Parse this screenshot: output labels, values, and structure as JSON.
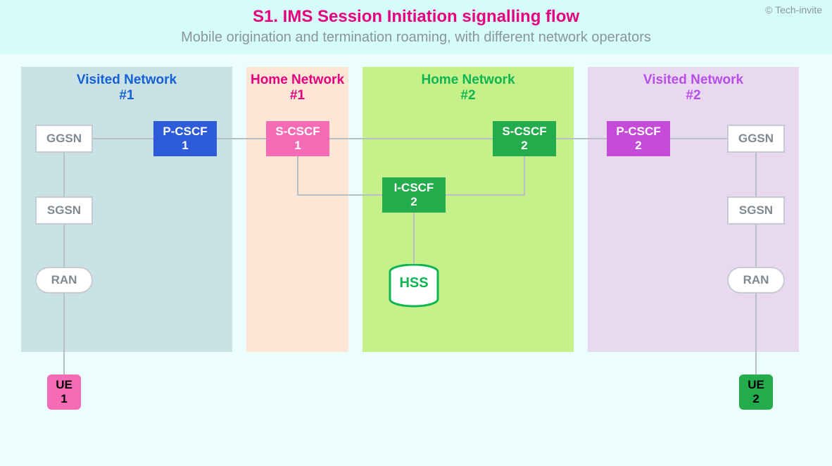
{
  "header": {
    "title": "S1. IMS Session Initiation signalling flow",
    "subtitle": "Mobile origination and termination roaming, with different network operators",
    "credit": "© Tech-invite"
  },
  "panels": {
    "vn1": {
      "line1": "Visited Network",
      "line2": "#1"
    },
    "hn1": {
      "line1": "Home Network",
      "line2": "#1"
    },
    "hn2": {
      "line1": "Home Network",
      "line2": "#2"
    },
    "vn2": {
      "line1": "Visited Network",
      "line2": "#2"
    }
  },
  "nodes": {
    "ggsn1": "GGSN",
    "sgsn1": "SGSN",
    "ran1": "RAN",
    "pcscf1_l1": "P-CSCF",
    "pcscf1_l2": "1",
    "scscf1_l1": "S-CSCF",
    "scscf1_l2": "1",
    "icscf2_l1": "I-CSCF",
    "icscf2_l2": "2",
    "scscf2_l1": "S-CSCF",
    "scscf2_l2": "2",
    "pcscf2_l1": "P-CSCF",
    "pcscf2_l2": "2",
    "ggsn2": "GGSN",
    "sgsn2": "SGSN",
    "ran2": "RAN",
    "hss": "HSS",
    "ue1_l1": "UE",
    "ue1_l2": "1",
    "ue2_l1": "UE",
    "ue2_l2": "2"
  }
}
